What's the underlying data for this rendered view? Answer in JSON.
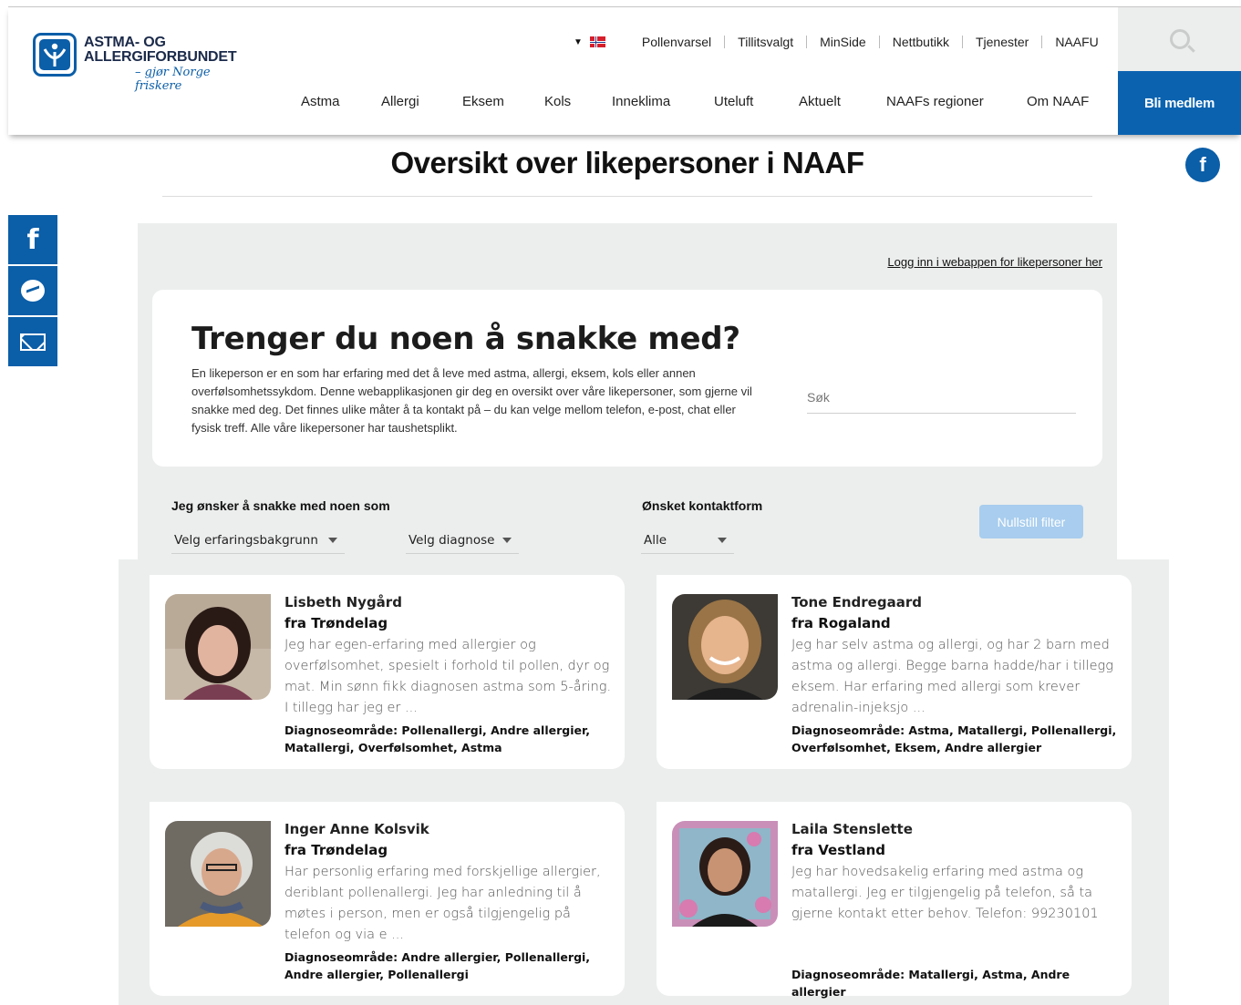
{
  "header": {
    "logo_line1": "ASTMA- OG",
    "logo_line2": "ALLERGIFORBUNDET",
    "logo_tagline": "– gjør Norge friskere",
    "utility_nav": [
      "Pollenvarsel",
      "Tillitsvalgt",
      "MinSide",
      "Nettbutikk",
      "Tjenester",
      "NAAFU"
    ],
    "main_nav": [
      "Astma",
      "Allergi",
      "Eksem",
      "Kols",
      "Inneklima",
      "Uteluft",
      "Aktuelt",
      "NAAFs regioner",
      "Om NAAF"
    ],
    "member_button": "Bli medlem",
    "language_caret": "▼",
    "brand_color": "#0b63b0"
  },
  "page": {
    "title": "Oversikt over likepersoner i NAAF",
    "login_link": "Logg inn i webappen for likepersoner her"
  },
  "intro": {
    "heading": "Trenger du noen å snakke med?",
    "text": "En likeperson er en som har erfaring med det å leve med astma, allergi, eksem, kols eller annen overfølsomhetssykdom. Denne webapplikasjonen gir deg en oversikt over våre likepersoner, som gjerne vil snakke med deg. Det finnes ulike måter å ta kontakt på – du kan velge mellom telefon, e-post, chat eller fysisk treff. Alle våre likepersoner har taushetsplikt.",
    "search_placeholder": "Søk"
  },
  "filters": {
    "talk_label": "Jeg ønsker å snakke med noen som",
    "experience_select": "Velg erfaringsbakgrunn",
    "diagnosis_select": "Velg diagnose",
    "contact_label": "Ønsket kontaktform",
    "contact_select": "Alle",
    "reset_button": "Nullstill filter"
  },
  "cards": [
    {
      "name": "Lisbeth Nygård",
      "region": "fra Trøndelag",
      "description": "Jeg har egen-erfaring med allergier og overfølsomhet, spesielt i forhold til pollen, dyr og mat. Min sønn fikk diagnosen astma som 5-åring. I tillegg har jeg er ...",
      "diagnosis": "Diagnoseområde: Pollenallergi, Andre allergier, Matallergi, Overfølsomhet, Astma"
    },
    {
      "name": "Tone Endregaard",
      "region": "fra Rogaland",
      "description": "Jeg har selv astma og allergi, og har 2 barn med astma og allergi. Begge barna hadde/har i tillegg eksem. Har erfaring med allergi som krever adrenalin-injeksjo ...",
      "diagnosis": "Diagnoseområde: Astma, Matallergi, Pollenallergi, Overfølsomhet, Eksem, Andre allergier"
    },
    {
      "name": "Inger Anne Kolsvik",
      "region": "fra Trøndelag",
      "description": "Har personlig erfaring med forskjellige allergier, deriblant pollenallergi. Jeg har anledning til å møtes i person, men er også tilgjengelig på telefon og via e ...",
      "diagnosis": "Diagnoseområde: Andre allergier, Pollenallergi, Andre allergier, Pollenallergi"
    },
    {
      "name": "Laila Stenslette",
      "region": "fra Vestland",
      "description": "Jeg har hovedsakelig erfaring med astma og matallergi. Jeg er tilgjengelig på telefon, så ta gjerne kontakt etter behov. Telefon: 99230101",
      "diagnosis": "Diagnoseområde: Matallergi, Astma, Andre allergier"
    }
  ]
}
